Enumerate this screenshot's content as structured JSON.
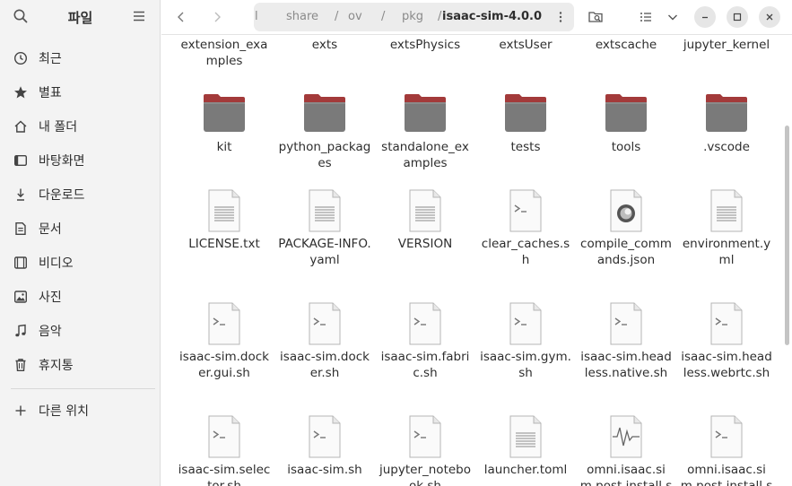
{
  "sidebar": {
    "title": "파일",
    "items": [
      {
        "label": "최근",
        "icon": "clock-icon"
      },
      {
        "label": "별표",
        "icon": "star-icon"
      },
      {
        "label": "내 폴더",
        "icon": "home-icon"
      },
      {
        "label": "바탕화면",
        "icon": "desktop-icon"
      },
      {
        "label": "다운로드",
        "icon": "download-icon"
      },
      {
        "label": "문서",
        "icon": "document-icon"
      },
      {
        "label": "비디오",
        "icon": "video-icon"
      },
      {
        "label": "사진",
        "icon": "picture-icon"
      },
      {
        "label": "음악",
        "icon": "music-icon"
      },
      {
        "label": "휴지통",
        "icon": "trash-icon"
      }
    ],
    "other_locations": "다른 위치"
  },
  "header": {
    "path": [
      "l",
      "share",
      "/",
      "ov",
      "/",
      "pkg",
      "/",
      "isaac-sim-4.0.0"
    ]
  },
  "files": {
    "row1": [
      "extension_examples",
      "exts",
      "extsPhysics",
      "extsUser",
      "extscache",
      "jupyter_kernel"
    ],
    "row2": [
      "kit",
      "python_packages",
      "standalone_examples",
      "tests",
      "tools",
      ".vscode"
    ],
    "row3": [
      "LICENSE.txt",
      "PACKAGE-INFO.yaml",
      "VERSION",
      "clear_caches.sh",
      "compile_commands.json",
      "environment.yml"
    ],
    "row4": [
      "isaac-sim.docker.gui.sh",
      "isaac-sim.docker.sh",
      "isaac-sim.fabric.sh",
      "isaac-sim.gym.sh",
      "isaac-sim.headless.native.sh",
      "isaac-sim.headless.webrtc.sh"
    ],
    "row5": [
      "isaac-sim.selector.sh",
      "isaac-sim.sh",
      "jupyter_notebook.sh",
      "launcher.toml",
      "omni.isaac.sim.post.install.sh",
      "omni.isaac.sim.post.install.sh"
    ]
  },
  "colors": {
    "folder_top": "#a33a3a",
    "folder_body": "#7a7a7a",
    "sidebar_bg": "#f3f3f3"
  }
}
